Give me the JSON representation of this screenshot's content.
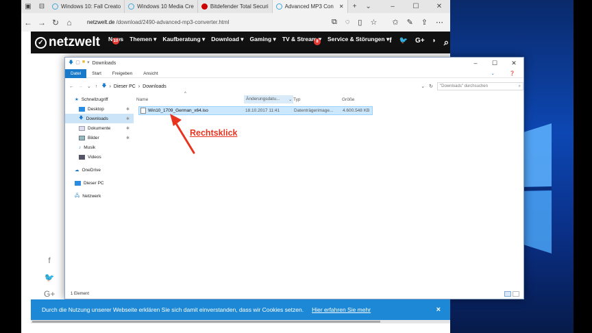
{
  "browser": {
    "tabs": [
      {
        "label": "Windows 10: Fall Creato"
      },
      {
        "label": "Windows 10 Media Cre"
      },
      {
        "label": "Bitdefender Total Securi"
      },
      {
        "label": "Advanced MP3 Con"
      }
    ],
    "url_domain": "netzwelt.de",
    "url_path": "/download/2490-advanced-mp3-converter.html"
  },
  "site": {
    "logo": "netzwelt",
    "menu": [
      {
        "label": "News",
        "badge": "10"
      },
      {
        "label": "Themen ▾"
      },
      {
        "label": "Kaufberatung ▾"
      },
      {
        "label": "Download ▾"
      },
      {
        "label": "Gaming ▾"
      },
      {
        "label": "TV & Stream ▾"
      },
      {
        "label": "Service & Störungen ▾",
        "badge": "8"
      }
    ],
    "social": [
      "f",
      "🐦",
      "G+",
      "◗",
      "⌕"
    ]
  },
  "explorer": {
    "title": "Downloads",
    "ribbon": [
      "Datei",
      "Start",
      "Freigeben",
      "Ansicht"
    ],
    "path": [
      "Dieser PC",
      "Downloads"
    ],
    "search_placeholder": "\"Downloads\" durchsuchen",
    "nav": {
      "quick_access": "Schnellzugriff",
      "items": [
        "Desktop",
        "Downloads",
        "Dokumente",
        "Bilder",
        "Musik",
        "Videos"
      ],
      "onedrive": "OneDrive",
      "this_pc": "Dieser PC",
      "network": "Netzwerk"
    },
    "columns": {
      "name": "Name",
      "date": "Änderungsdatu...",
      "type": "Typ",
      "size": "Größe"
    },
    "file": {
      "name": "Win10_1709_German_x64.iso",
      "date": "18.10.2017 11:41",
      "type": "Datenträgerimage...",
      "size": "4.600.548 KB"
    },
    "status": "1 Element"
  },
  "annotation": "Rechtsklick",
  "cookie": {
    "text": "Durch die Nutzung unserer Webseite erklären Sie sich damit einverstanden, dass wir Cookies setzen.",
    "link": "Hier erfahren Sie mehr",
    "close": "×"
  },
  "colors": {
    "accent": "#1979ca",
    "annotation": "#e8331e",
    "cookie_bar": "#1d89d6"
  }
}
